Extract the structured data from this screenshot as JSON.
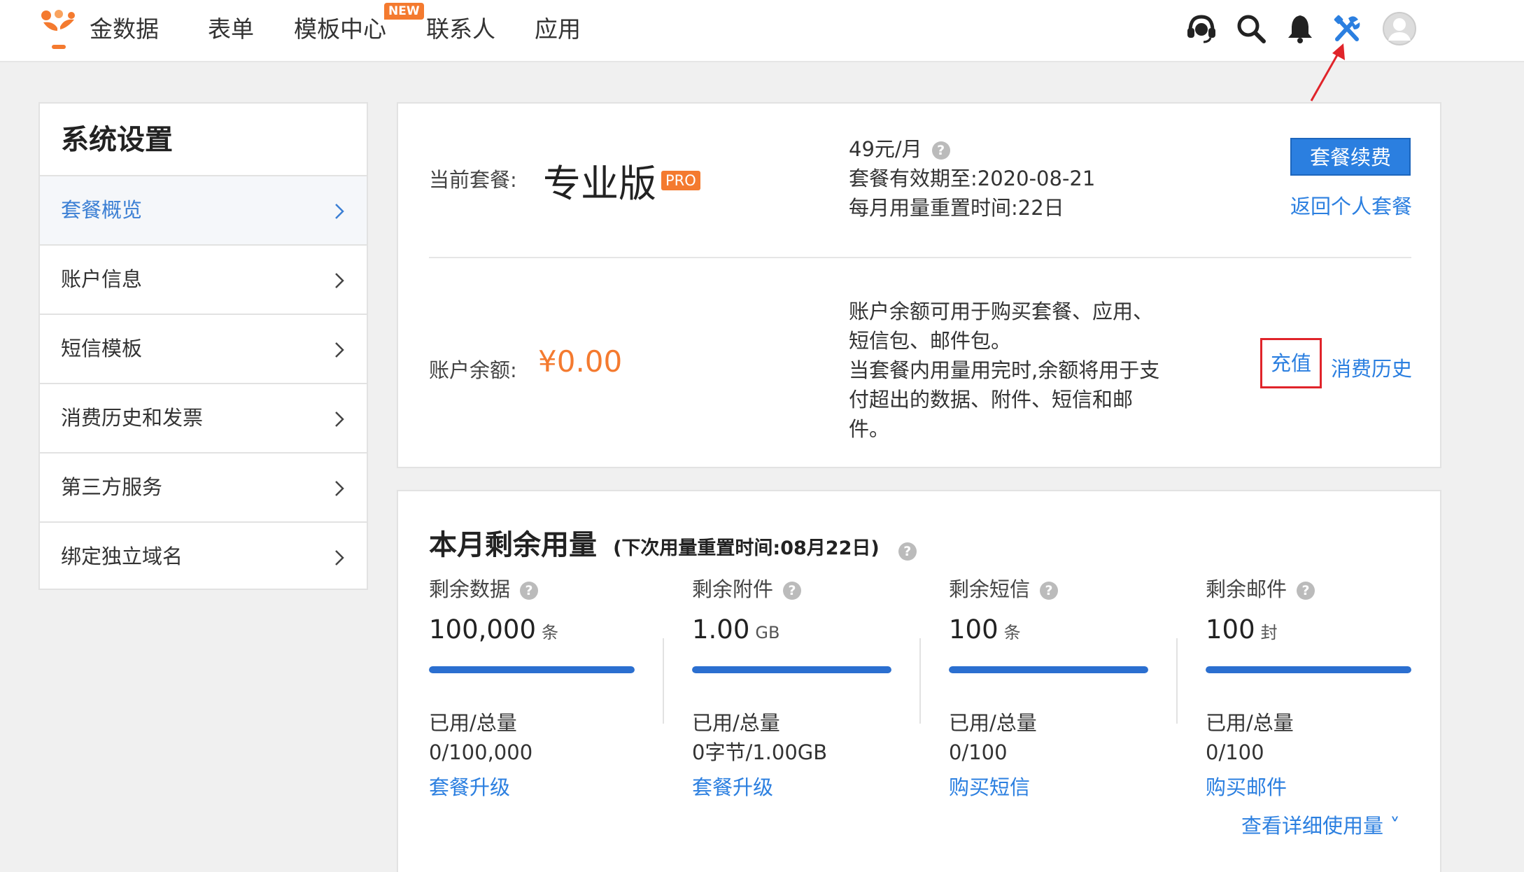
{
  "header": {
    "brand": "金数据",
    "nav": [
      {
        "label": "表单"
      },
      {
        "label": "模板中心",
        "badge": "NEW"
      },
      {
        "label": "联系人"
      },
      {
        "label": "应用"
      }
    ],
    "icons": [
      "headset-icon",
      "search-icon",
      "bell-icon",
      "tools-icon",
      "avatar"
    ],
    "accent": "#2b7fe0"
  },
  "sidebar": {
    "title": "系统设置",
    "items": [
      {
        "label": "套餐概览",
        "active": true
      },
      {
        "label": "账户信息"
      },
      {
        "label": "短信模板"
      },
      {
        "label": "消费历史和发票"
      },
      {
        "label": "第三方服务"
      },
      {
        "label": "绑定独立域名"
      }
    ]
  },
  "plan": {
    "label": "当前套餐:",
    "name": "专业版",
    "badge": "PRO",
    "price": "49元/月",
    "expiry": "套餐有效期至:2020-08-21",
    "reset": "每月用量重置时间:22日",
    "renew_button": "套餐续费",
    "back_link": "返回个人套餐"
  },
  "balance": {
    "label": "账户余额:",
    "amount": "¥0.00",
    "desc_line1": "账户余额可用于购买套餐、应用、短信包、邮件包。",
    "desc_line2": "当套餐内用量用完时,余额将用于支付超出的数据、附件、短信和邮件。",
    "recharge": "充值",
    "history": "消费历史",
    "highlight_color": "#e0242a"
  },
  "usage": {
    "title": "本月剩余用量",
    "subtitle": "(下次用量重置时间:08月22日)",
    "used_total_label": "已用/总量",
    "columns": [
      {
        "head": "剩余数据",
        "value": "100,000",
        "unit": "条",
        "used_total": "0/100,000",
        "link": "套餐升级",
        "remaining_fraction": 1.0
      },
      {
        "head": "剩余附件",
        "value": "1.00",
        "unit": "GB",
        "used_total": "0字节/1.00GB",
        "link": "套餐升级",
        "remaining_fraction": 1.0
      },
      {
        "head": "剩余短信",
        "value": "100",
        "unit": "条",
        "used_total": "0/100",
        "link": "购买短信",
        "remaining_fraction": 1.0
      },
      {
        "head": "剩余邮件",
        "value": "100",
        "unit": "封",
        "used_total": "0/100",
        "link": "购买邮件",
        "remaining_fraction": 1.0
      }
    ],
    "detail_link": "查看详细使用量 ˅"
  }
}
